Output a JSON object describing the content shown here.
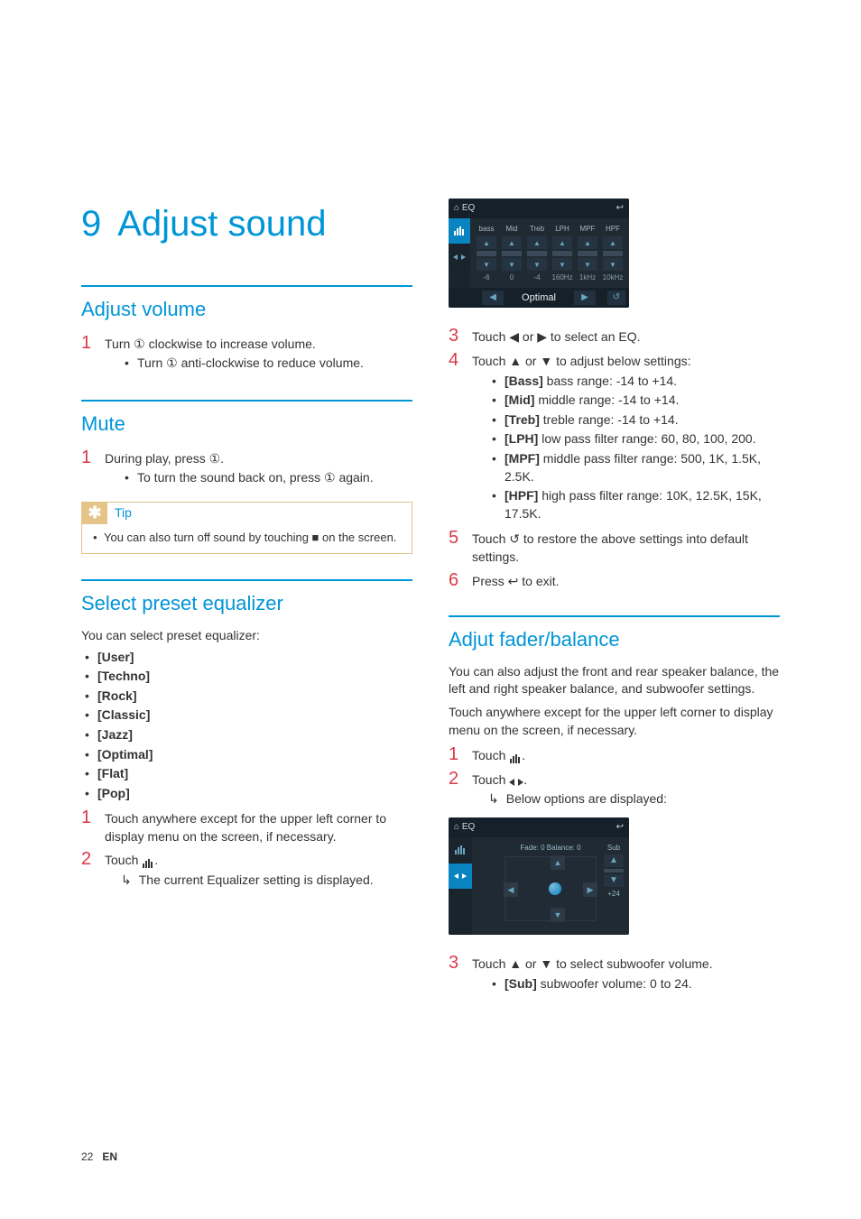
{
  "chapter": {
    "number": "9",
    "title": "Adjust sound"
  },
  "sections": {
    "adjust_volume": {
      "heading": "Adjust volume",
      "step1": "Turn ① clockwise to increase volume.",
      "step1_sub1": "Turn ① anti-clockwise to reduce volume."
    },
    "mute": {
      "heading": "Mute",
      "step1": "During play, press ①.",
      "step1_sub1": "To turn the sound back on, press ① again."
    },
    "tip": {
      "label": "Tip",
      "text": "You can also turn off sound by touching ■ on the screen."
    },
    "preset_eq": {
      "heading": "Select preset equalizer",
      "intro": "You can select preset equalizer:",
      "items": [
        "[User]",
        "[Techno]",
        "[Rock]",
        "[Classic]",
        "[Jazz]",
        "[Optimal]",
        "[Flat]",
        "[Pop]"
      ],
      "step1": "Touch anywhere except for the upper left corner to display menu on the screen, if necessary.",
      "step2_prefix": "Touch ",
      "step2_result": "The current Equalizer setting is displayed."
    },
    "eq_steps": {
      "step3": "Touch ◀ or ▶ to select an EQ.",
      "step4": "Touch ▲ or ▼ to adjust below settings:",
      "step4_items": [
        {
          "label": "[Bass]",
          "text": " bass range: -14 to +14."
        },
        {
          "label": "[Mid]",
          "text": " middle range: -14 to +14."
        },
        {
          "label": "[Treb]",
          "text": " treble range: -14 to +14."
        },
        {
          "label": "[LPH]",
          "text": " low pass filter range: 60, 80, 100, 200."
        },
        {
          "label": "[MPF]",
          "text": " middle pass filter range: 500, 1K, 1.5K, 2.5K."
        },
        {
          "label": "[HPF]",
          "text": " high pass filter range: 10K, 12.5K, 15K, 17.5K."
        }
      ],
      "step5": "Touch ↺ to restore the above settings into default settings.",
      "step6": "Press ↩ to exit."
    },
    "fader": {
      "heading": "Adjut fader/balance",
      "intro1": "You can also adjust the front and rear speaker balance, the left and right speaker balance, and subwoofer settings.",
      "intro2": "Touch anywhere except for the upper left corner to display menu on the screen, if necessary.",
      "step1_prefix": "Touch ",
      "step2_prefix": "Touch ",
      "step2_result": "Below options are displayed:",
      "step3": "Touch ▲ or ▼ to select subwoofer volume.",
      "step3_sub_label": "[Sub]",
      "step3_sub_text": " subwoofer volume: 0 to 24."
    }
  },
  "device1": {
    "topbar_left": "⌂  EQ",
    "topbar_right": "↩",
    "side_icons": [
      "bars",
      "balance"
    ],
    "columns": [
      {
        "label": "bass",
        "val": "-6"
      },
      {
        "label": "Mid",
        "val": "0"
      },
      {
        "label": "Treb",
        "val": "-4"
      },
      {
        "label": "LPH",
        "val": "160Hz"
      },
      {
        "label": "MPF",
        "val": "1kHz"
      },
      {
        "label": "HPF",
        "val": "10kHz"
      }
    ],
    "preset": "Optimal"
  },
  "device2": {
    "topbar_left": "⌂  EQ",
    "topbar_right": "↩",
    "side_icons": [
      "bars",
      "balance"
    ],
    "caption": "Fade: 0 Balance: 0",
    "sub_label": "Sub",
    "sub_val": "+24"
  },
  "footer": {
    "page": "22",
    "lang": "EN"
  }
}
